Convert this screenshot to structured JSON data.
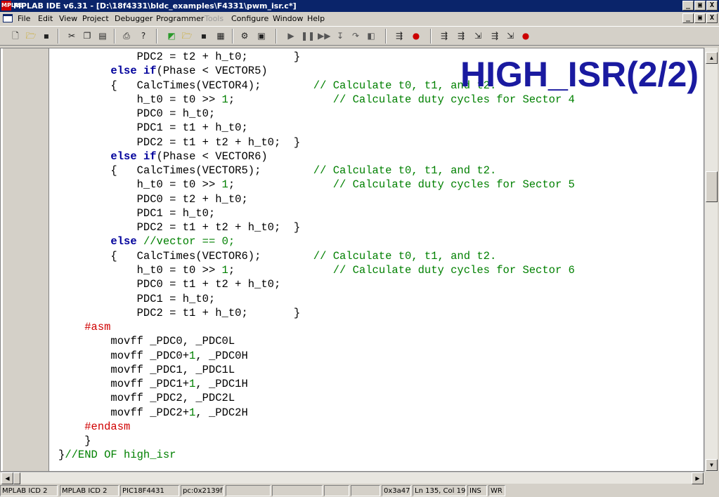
{
  "window": {
    "title": "MPLAB IDE v6.31 - [D:\\18f4331\\bldc_examples\\F4331\\pwm_isr.c*]",
    "app_icon_label": "MPLAB",
    "minimize": "_",
    "restore": "▣",
    "close": "X"
  },
  "menu": {
    "items": [
      "File",
      "Edit",
      "View",
      "Project",
      "Debugger",
      "Programmer",
      "Tools",
      "Configure",
      "Window",
      "Help"
    ]
  },
  "overlay": {
    "title": "HIGH_ISR(2/2)"
  },
  "code": {
    "line_01": "            PDC2 = t2 + h_t0;       }",
    "line_06": "            PDC0 = h_t0;",
    "line_07": "            PDC1 = t1 + h_t0;",
    "line_08": "            PDC2 = t1 + t2 + h_t0;  }",
    "line_12": "            PDC0 = t2 + h_t0;",
    "line_13": "            PDC1 = h_t0;",
    "line_14": "            PDC2 = t1 + t2 + h_t0;  }",
    "line_18": "            PDC0 = t1 + t2 + h_t0;",
    "line_19": "            PDC1 = h_t0;",
    "line_20": "            PDC2 = t1 + h_t0;       }",
    "line_22": "        movff _PDC0, _PDC0L",
    "line_24": "        movff _PDC1, _PDC1L",
    "line_26": "        movff _PDC2, _PDC2L",
    "line_29": "    }",
    "indent8": "        ",
    "indent12": "            ",
    "brace_open": "{   ",
    "pad_calc": "        ",
    "pad_ht0": "               ",
    "else_kw": "else",
    "if_kw": "if",
    "phase_v5": "(Phase < VECTOR5)",
    "phase_v6": "(Phase < VECTOR6)",
    "vector_comment": "//vector == 0;",
    "calc_v4": "CalcTimes(VECTOR4);",
    "calc_v5": "CalcTimes(VECTOR5);",
    "calc_v6": "CalcTimes(VECTOR6);",
    "comment_calc": "// Calculate t0, t1, and t2.",
    "ht0_prefix": "h_t0 = t0 >> ",
    "ht0_num": "1",
    "ht0_suffix": ";",
    "comment_sector4": "// Calculate duty cycles for Sector 4",
    "comment_sector5": "// Calculate duty cycles for Sector 5",
    "comment_sector6": "// Calculate duty cycles for Sector 6",
    "asm_directive": "#asm",
    "endasm_directive": "#endasm",
    "movff_prefix0": "movff _PDC0+",
    "movff_suffix0": ", _PDC0H",
    "movff_prefix1": "movff _PDC1+",
    "movff_suffix1": ", _PDC1H",
    "movff_prefix2": "movff _PDC2+",
    "movff_suffix2": ", _PDC2H",
    "movff_num": "1",
    "end_brace": "}",
    "end_comment": "//END OF high_isr"
  },
  "status": {
    "cells": [
      "MPLAB ICD 2",
      "MPLAB ICD 2",
      "PIC18F4431",
      "pc:0x2139f!",
      "",
      "",
      "",
      "",
      "0x3a47",
      "Ln 135, Col 19",
      "INS",
      "WR"
    ]
  },
  "colors": {
    "titlebar": "#0a246a",
    "keyword": "#00009c",
    "comment": "#008000",
    "preprocessor": "#d00000",
    "overlay_title": "#1a1aa0"
  }
}
